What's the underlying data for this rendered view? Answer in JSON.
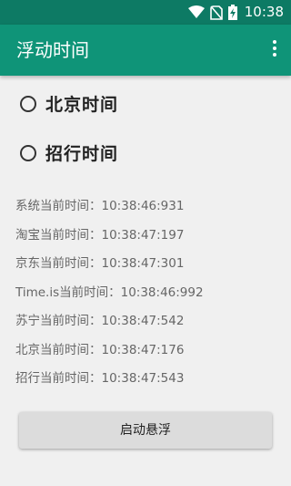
{
  "status_bar": {
    "time": "10:38",
    "icons": [
      "wifi-icon",
      "no-sim-icon",
      "battery-charging-icon"
    ]
  },
  "app_bar": {
    "title": "浮动时间",
    "menu_icon": "overflow-menu-icon"
  },
  "options": [
    {
      "label": "北京时间",
      "checked": false
    },
    {
      "label": "招行时间",
      "checked": false
    }
  ],
  "times": [
    "系统当前时间：10:38:46:931",
    "淘宝当前时间：10:38:47:197",
    "京东当前时间：10:38:47:301",
    "Time.is当前时间：10:38:46:992",
    "苏宁当前时间：10:38:47:542",
    "北京当前时间：10:38:47:176",
    "招行当前时间：10:38:47:543"
  ],
  "start_button_label": "启动悬浮",
  "colors": {
    "status_bar": "#0d7a64",
    "app_bar": "#0f9478",
    "background": "#f0f0f0"
  }
}
